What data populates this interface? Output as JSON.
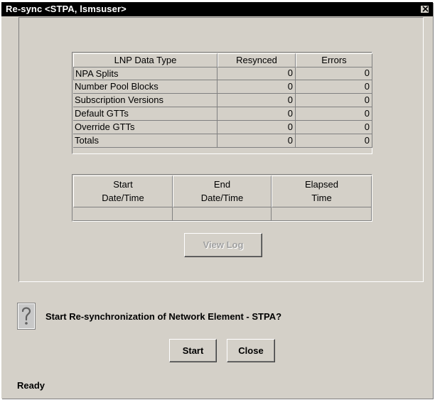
{
  "window": {
    "title": "Re-sync <STPA, lsmsuser>",
    "close_icon": "close-x-icon"
  },
  "data_table": {
    "columns": [
      "LNP Data Type",
      "Resynced",
      "Errors"
    ],
    "rows": [
      {
        "type": "NPA Splits",
        "resynced": "0",
        "errors": "0"
      },
      {
        "type": "Number Pool Blocks",
        "resynced": "0",
        "errors": "0"
      },
      {
        "type": "Subscription Versions",
        "resynced": "0",
        "errors": "0"
      },
      {
        "type": "Default GTTs",
        "resynced": "0",
        "errors": "0"
      },
      {
        "type": "Override GTTs",
        "resynced": "0",
        "errors": "0"
      },
      {
        "type": "Totals",
        "resynced": "0",
        "errors": "0"
      }
    ]
  },
  "time_table": {
    "columns": [
      {
        "line1": "Start",
        "line2": "Date/Time"
      },
      {
        "line1": "End",
        "line2": "Date/Time"
      },
      {
        "line1": "Elapsed",
        "line2": "Time"
      }
    ],
    "values": [
      "",
      "",
      ""
    ]
  },
  "buttons": {
    "view_log": "View Log",
    "start": "Start",
    "close": "Close"
  },
  "prompt": {
    "icon": "question-icon",
    "message": "Start Re-synchronization of Network Element - STPA?"
  },
  "status": "Ready"
}
